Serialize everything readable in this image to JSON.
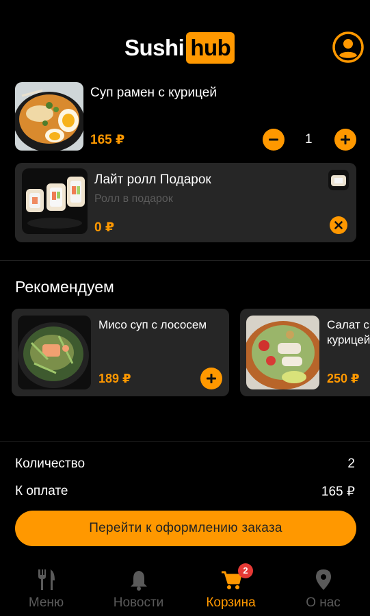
{
  "header": {
    "logo_text": "Sushi",
    "logo_badge": "hub",
    "profile_icon": "user-circle-icon"
  },
  "cart": {
    "items": [
      {
        "title": "Суп рамен с курицей",
        "price": "165 ₽",
        "quantity": "1"
      }
    ],
    "gift": {
      "title": "Лайт ролл Подарок",
      "subtitle": "Ролл в подарок",
      "price": "0 ₽"
    }
  },
  "recommend": {
    "title": "Рекомендуем",
    "items": [
      {
        "title": "Мисо суп с лососем",
        "price": "189 ₽"
      },
      {
        "title_line1": "Салат с",
        "title_line2": "курицей",
        "price": "250 ₽"
      }
    ]
  },
  "summary": {
    "count_label": "Количество",
    "count_value": "2",
    "total_label": "К оплате",
    "total_value": "165 ₽"
  },
  "checkout_label": "Перейти к оформлению заказа",
  "nav": {
    "items": [
      {
        "label": "Меню",
        "icon": "fork-knife-icon"
      },
      {
        "label": "Новости",
        "icon": "bell-icon"
      },
      {
        "label": "Корзина",
        "icon": "cart-icon",
        "badge": "2",
        "active": true
      },
      {
        "label": "О нас",
        "icon": "location-pin-icon"
      }
    ]
  },
  "colors": {
    "accent": "#ff9800",
    "background": "#000000",
    "card": "#262626",
    "muted": "#5a5a5a",
    "badge": "#e53935"
  }
}
